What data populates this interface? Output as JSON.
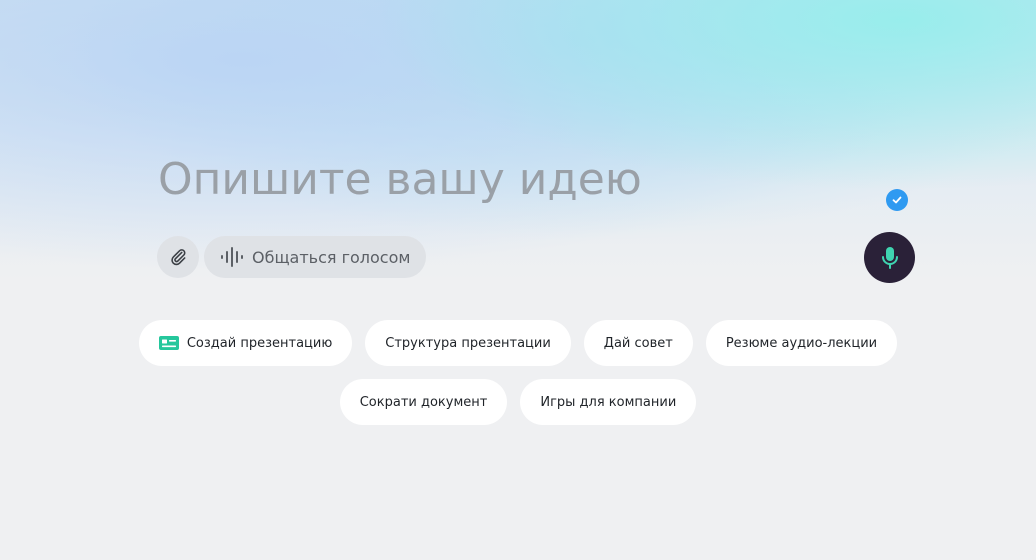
{
  "prompt": {
    "placeholder": "Опишите вашу идею",
    "value": ""
  },
  "toolbar": {
    "attach_icon": "paperclip-icon",
    "voice_button_label": "Общаться голосом",
    "voice_icon": "soundwave-icon",
    "mic_icon": "microphone-icon",
    "verified_icon": "check-badge-icon"
  },
  "suggestions": {
    "row1": [
      {
        "label": "Создай презентацию",
        "icon": "presentation-icon"
      },
      {
        "label": "Структура презентации"
      },
      {
        "label": "Дай совет"
      },
      {
        "label": "Резюме аудио-лекции"
      }
    ],
    "row2": [
      {
        "label": "Сократи документ"
      },
      {
        "label": "Игры для компании"
      }
    ]
  },
  "colors": {
    "mic_button_bg": "#2a2138",
    "mic_icon": "#3fd4b0",
    "badge_blue": "#2f9af1",
    "presentation_icon": "#25c79c"
  }
}
